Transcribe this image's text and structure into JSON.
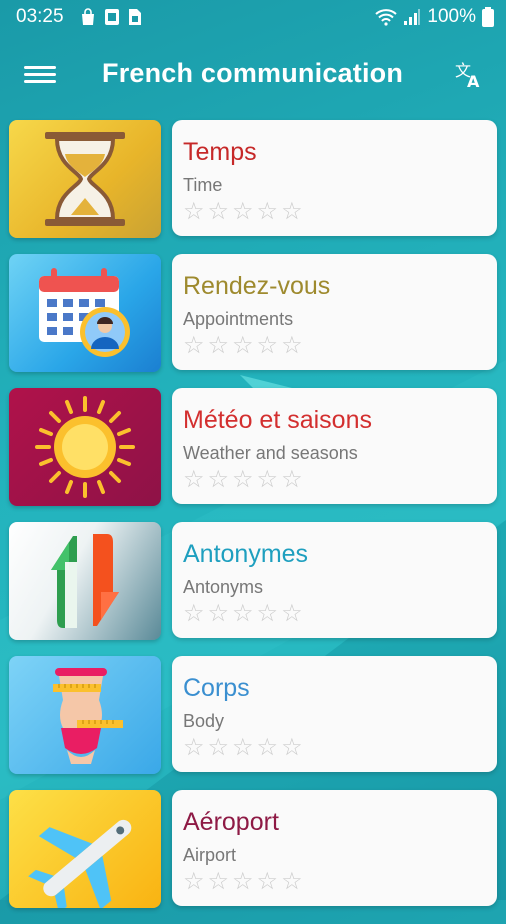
{
  "status": {
    "time": "03:25",
    "battery": "100%"
  },
  "appbar": {
    "title": "French communication",
    "menu_icon": "hamburger-menu-icon",
    "translate_icon": "translate-icon"
  },
  "topics": [
    {
      "fr": "Temps",
      "en": "Time",
      "color": "#c62828",
      "thumb": "hourglass",
      "stars": 0
    },
    {
      "fr": "Rendez-vous",
      "en": "Appointments",
      "color": "#9e8a2e",
      "thumb": "calendar",
      "stars": 0
    },
    {
      "fr": "Météo et saisons",
      "en": "Weather and seasons",
      "color": "#d32f2f",
      "thumb": "sun",
      "stars": 0
    },
    {
      "fr": "Antonymes",
      "en": "Antonyms",
      "color": "#1e9fbf",
      "thumb": "arrows",
      "stars": 0
    },
    {
      "fr": "Corps",
      "en": "Body",
      "color": "#3a8fd0",
      "thumb": "body",
      "stars": 0
    },
    {
      "fr": "Aéroport",
      "en": "Airport",
      "color": "#8e1a45",
      "thumb": "plane",
      "stars": 0
    }
  ],
  "star_glyph": "☆"
}
